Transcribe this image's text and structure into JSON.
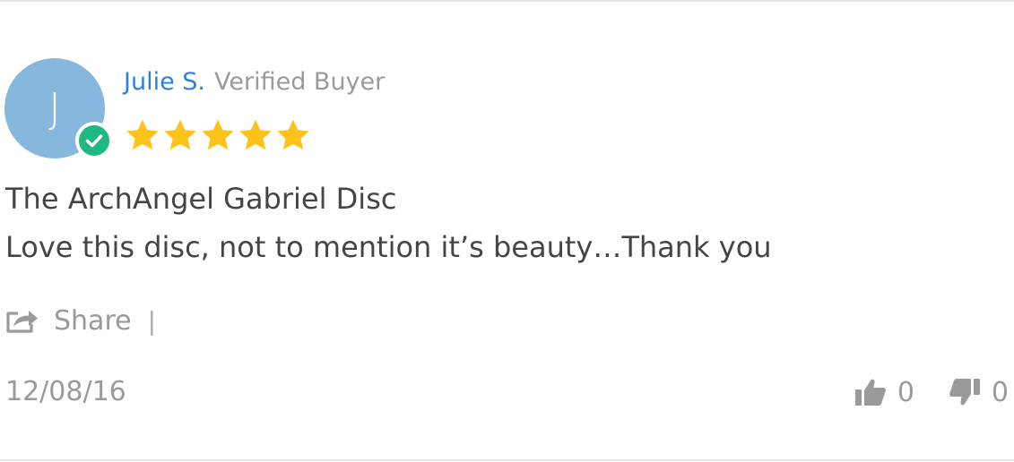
{
  "review": {
    "author_initial": "J",
    "author_name": "Julie S.",
    "author_status": "Verified Buyer",
    "rating": 5,
    "rating_max": 5,
    "title": "The ArchAngel Gabriel Disc",
    "body": "Love this disc, not to mention it’s beauty…Thank you",
    "date": "12/08/16"
  },
  "actions": {
    "share_label": "Share",
    "separator": "|",
    "thumbs_up_count": "0",
    "thumbs_down_count": "0"
  },
  "colors": {
    "author_link": "#2f7fdc",
    "star": "#ffc21a",
    "avatar_bg": "#86b7dc",
    "verified_badge": "#1eb881",
    "muted_text": "#9a9a9a",
    "body_text": "#454545"
  },
  "icons": {
    "avatar_badge": "check-circle-icon",
    "rating": "star-icon",
    "share": "share-icon",
    "vote_up": "thumbs-up-icon",
    "vote_down": "thumbs-down-icon"
  }
}
